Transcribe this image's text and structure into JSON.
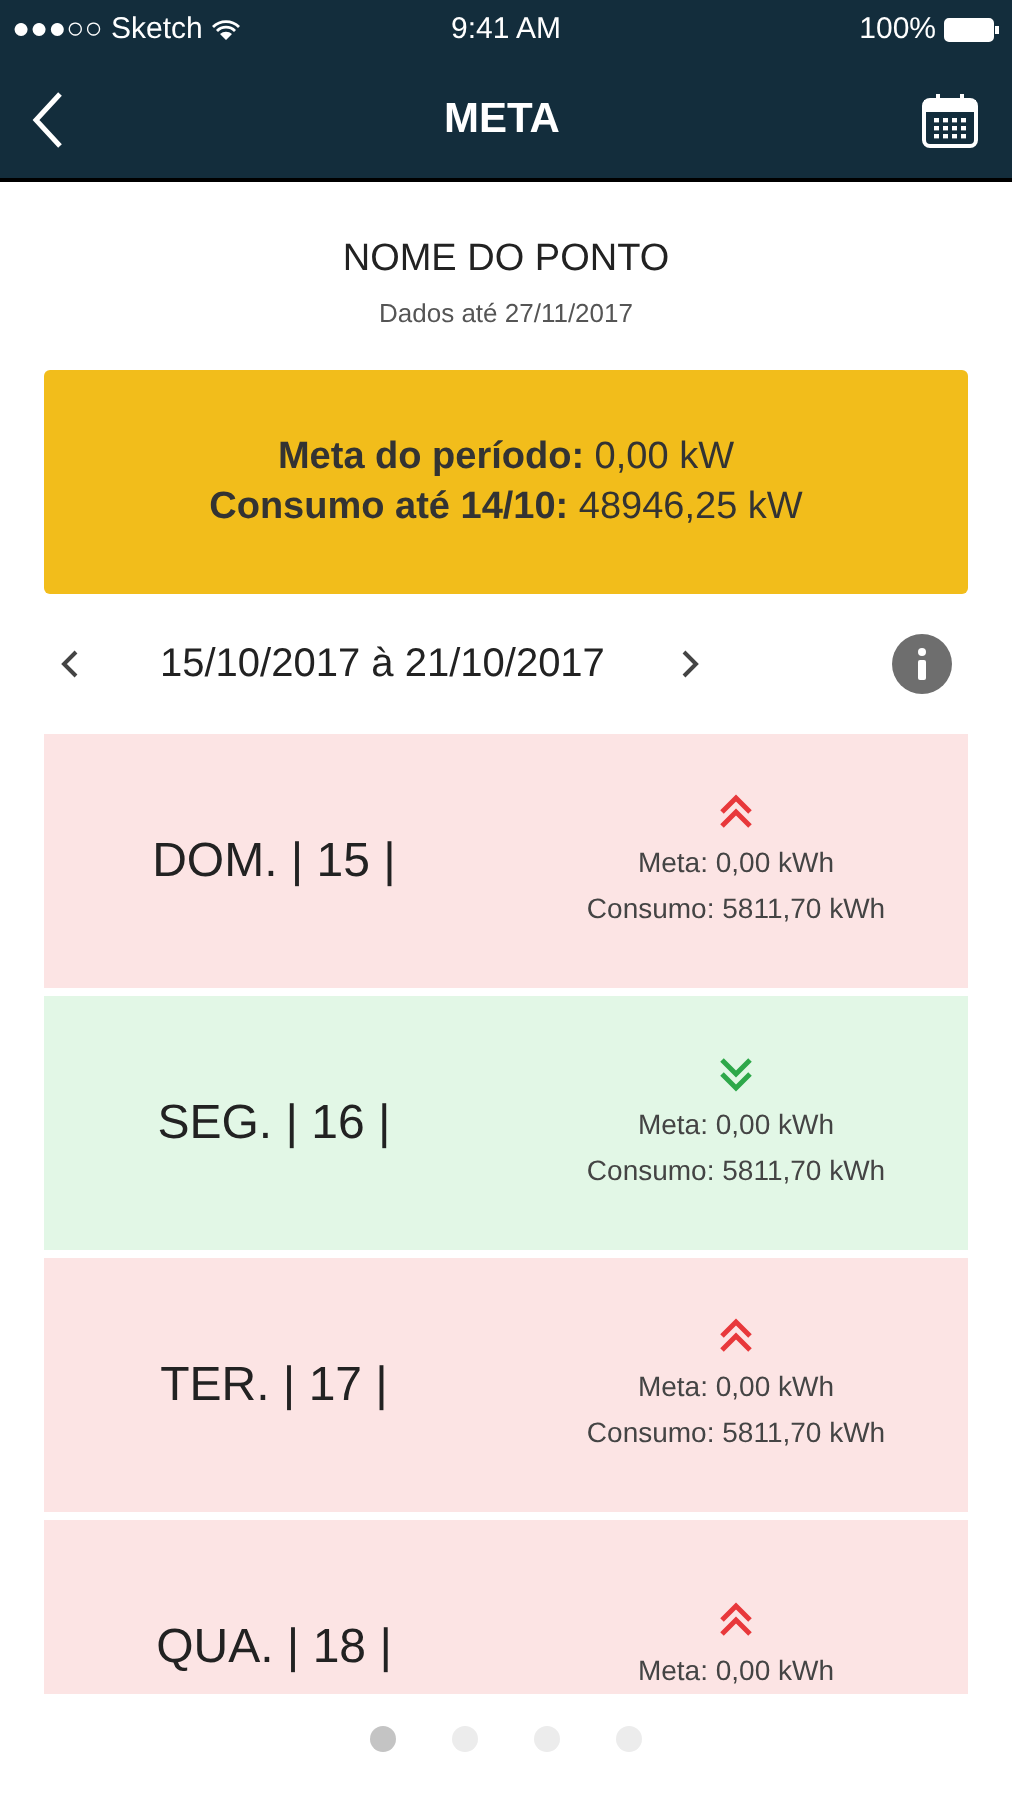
{
  "status_bar": {
    "carrier": "●●●○○ Sketch",
    "time": "9:41 AM",
    "battery": "100%"
  },
  "nav": {
    "title": "META"
  },
  "header": {
    "title": "NOME DO PONTO",
    "subtitle": "Dados até 27/11/2017"
  },
  "summary": {
    "lines": [
      "**Meta do período:** 0,00 kW",
      "**Consumo até 14/10:** 48946,25 kW"
    ]
  },
  "period": {
    "label": "15/10/2017 à 21/10/2017"
  },
  "days": [
    {
      "day": "DOM. | 15 |",
      "kind": "up",
      "meta": "Meta: 0,00 kWh",
      "consumo": "Consumo: 5811,70 kWh"
    },
    {
      "day": "SEG. | 16 |",
      "kind": "down",
      "meta": "Meta: 0,00 kWh",
      "consumo": "Consumo: 5811,70 kWh"
    },
    {
      "day": "TER. | 17 |",
      "kind": "up",
      "meta": "Meta: 0,00 kWh",
      "consumo": "Consumo: 5811,70 kWh"
    },
    {
      "day": "QUA. | 18 |",
      "kind": "up",
      "meta": "Meta: 0,00 kWh"
    }
  ],
  "pager": [
    {
      "selected": true
    },
    {
      "selected": false
    },
    {
      "selected": false
    },
    {
      "selected": false
    }
  ]
}
